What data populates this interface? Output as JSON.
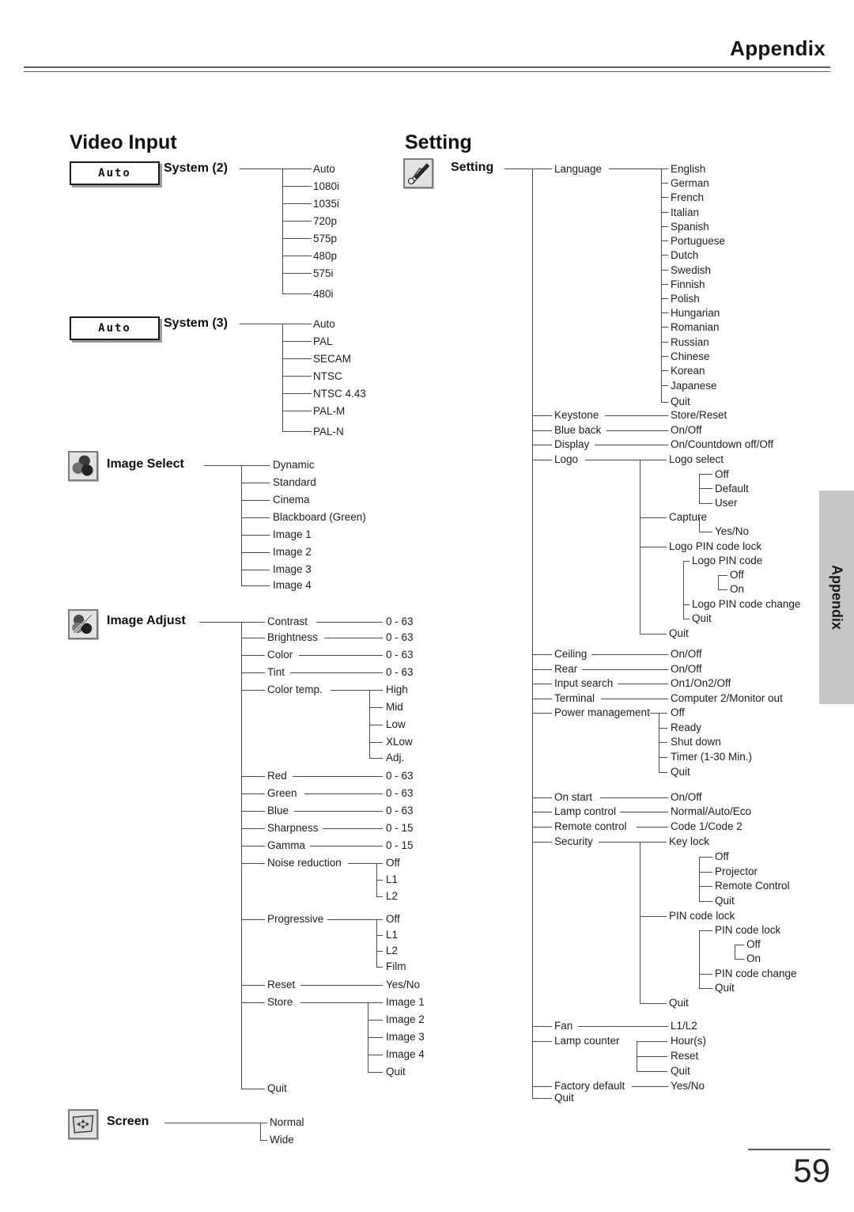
{
  "header": {
    "title": "Appendix",
    "side_tab": "Appendix"
  },
  "footer": {
    "page_number": "59"
  },
  "sections": {
    "video_input": {
      "title": "Video Input"
    },
    "setting": {
      "title": "Setting"
    }
  },
  "video_input": {
    "system2": {
      "button_label": "Auto",
      "label": "System (2)",
      "options": [
        "Auto",
        "1080i",
        "1035i",
        "720p",
        "575p",
        "480p",
        "575i",
        "480i"
      ]
    },
    "system3": {
      "button_label": "Auto",
      "label": "System (3)",
      "options": [
        "Auto",
        "PAL",
        "SECAM",
        "NTSC",
        "NTSC 4.43",
        "PAL-M",
        "PAL-N"
      ]
    },
    "image_select": {
      "icon": "image-select-icon",
      "label": "Image Select",
      "options": [
        "Dynamic",
        "Standard",
        "Cinema",
        "Blackboard (Green)",
        "Image 1",
        "Image 2",
        "Image 3",
        "Image 4"
      ]
    },
    "image_adjust": {
      "icon": "image-adjust-icon",
      "label": "Image Adjust",
      "items": [
        {
          "label": "Contrast",
          "value": "0 - 63"
        },
        {
          "label": "Brightness",
          "value": "0 - 63"
        },
        {
          "label": "Color",
          "value": "0 - 63"
        },
        {
          "label": "Tint",
          "value": "0 - 63"
        },
        {
          "label": "Color temp.",
          "children": [
            "High",
            "Mid",
            "Low",
            "XLow",
            "Adj."
          ]
        },
        {
          "label": "Red",
          "value": "0 - 63"
        },
        {
          "label": "Green",
          "value": "0 - 63"
        },
        {
          "label": "Blue",
          "value": "0 - 63"
        },
        {
          "label": "Sharpness",
          "value": "0 - 15"
        },
        {
          "label": "Gamma",
          "value": "0 - 15"
        },
        {
          "label": "Noise reduction",
          "children": [
            "Off",
            "L1",
            "L2"
          ]
        },
        {
          "label": "Progressive",
          "children": [
            "Off",
            "L1",
            "L2",
            "Film"
          ]
        },
        {
          "label": "Reset",
          "value": "Yes/No"
        },
        {
          "label": "Store",
          "children": [
            "Image 1",
            "Image 2",
            "Image 3",
            "Image 4",
            "Quit"
          ]
        },
        {
          "label": "Quit"
        }
      ]
    },
    "screen": {
      "icon": "screen-icon",
      "label": "Screen",
      "options": [
        "Normal",
        "Wide"
      ]
    }
  },
  "setting": {
    "icon": "setting-icon",
    "label": "Setting",
    "items": [
      {
        "label": "Language",
        "children": [
          "English",
          "German",
          "French",
          "Italian",
          "Spanish",
          "Portuguese",
          "Dutch",
          "Swedish",
          "Finnish",
          "Polish",
          "Hungarian",
          "Romanian",
          "Russian",
          "Chinese",
          "Korean",
          "Japanese",
          "Quit"
        ]
      },
      {
        "label": "Keystone",
        "value": "Store/Reset"
      },
      {
        "label": "Blue back",
        "value": "On/Off"
      },
      {
        "label": "Display",
        "value": "On/Countdown off/Off"
      },
      {
        "label": "Logo",
        "children": [
          {
            "label": "Logo select",
            "children": [
              "Off",
              "Default",
              "User"
            ]
          },
          {
            "label": "Capture",
            "children": [
              "Yes/No"
            ]
          },
          {
            "label": "Logo PIN code lock",
            "children": [
              {
                "label": "Logo PIN code",
                "children": [
                  "Off",
                  "On"
                ]
              },
              {
                "label": "Logo PIN code change"
              },
              {
                "label": "Quit"
              }
            ]
          },
          {
            "label": "Quit"
          }
        ]
      },
      {
        "label": "Ceiling",
        "value": "On/Off"
      },
      {
        "label": "Rear",
        "value": "On/Off"
      },
      {
        "label": "Input search",
        "value": "On1/On2/Off"
      },
      {
        "label": "Terminal",
        "value": "Computer 2/Monitor out"
      },
      {
        "label": "Power management",
        "children": [
          "Off",
          "Ready",
          "Shut down",
          "Timer (1-30 Min.)",
          "Quit"
        ]
      },
      {
        "label": "On start",
        "value": "On/Off"
      },
      {
        "label": "Lamp control",
        "value": "Normal/Auto/Eco"
      },
      {
        "label": "Remote control",
        "value": "Code 1/Code 2"
      },
      {
        "label": "Security",
        "children": [
          {
            "label": "Key lock",
            "children": [
              "Off",
              "Projector",
              "Remote Control",
              "Quit"
            ]
          },
          {
            "label": "PIN code lock",
            "children": [
              {
                "label": "PIN code lock",
                "children": [
                  "Off",
                  "On"
                ]
              },
              {
                "label": "PIN code change"
              },
              {
                "label": "Quit"
              }
            ]
          },
          {
            "label": "Quit"
          }
        ]
      },
      {
        "label": "Fan",
        "value": "L1/L2"
      },
      {
        "label": "Lamp counter",
        "children": [
          "Hour(s)",
          "Reset",
          "Quit"
        ]
      },
      {
        "label": "Factory default",
        "value": "Yes/No"
      },
      {
        "label": "Quit"
      }
    ]
  }
}
